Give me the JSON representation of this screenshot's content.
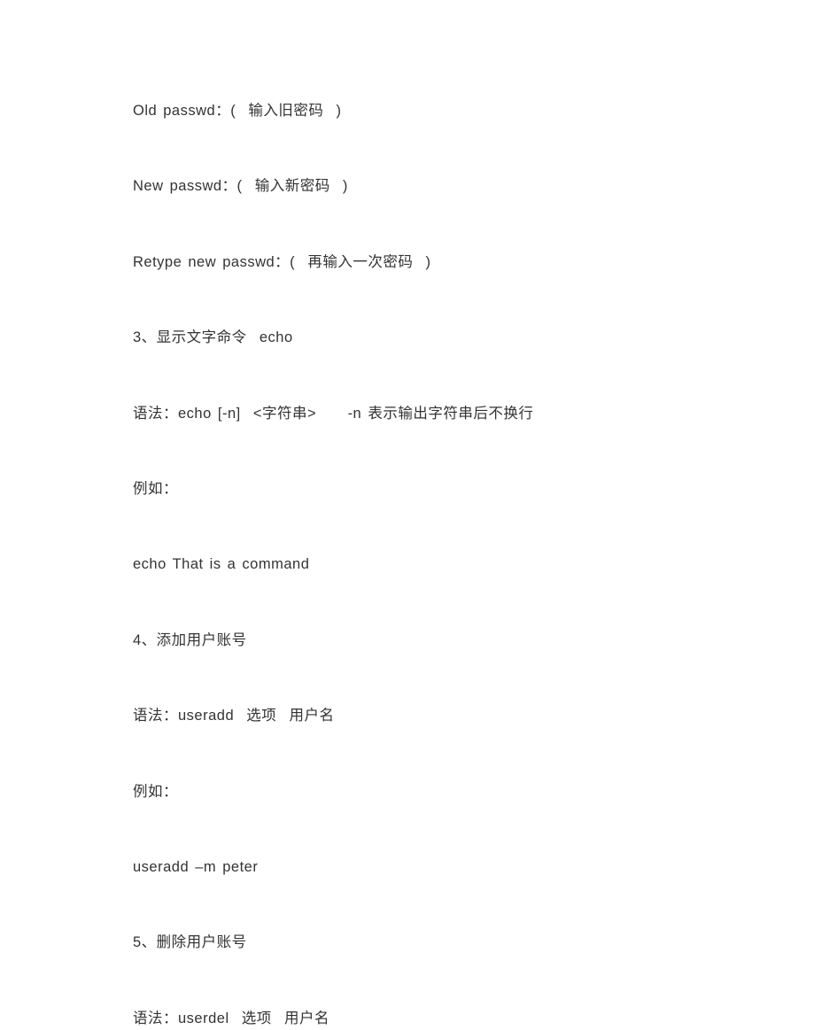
{
  "lines": [
    "Old passwd：(  输入旧密码  )",
    "New passwd：(  输入新密码  )",
    "Retype new passwd：(  再输入一次密码  )",
    "3、显示文字命令  echo",
    "语法：echo [-n]  <字符串>     -n 表示输出字符串后不换行",
    "例如：",
    "echo That is a command",
    "4、添加用户账号",
    "语法：useradd  选项  用户名",
    "例如：",
    "useradd –m peter",
    "5、删除用户账号",
    "语法：userdel  选项  用户名"
  ]
}
